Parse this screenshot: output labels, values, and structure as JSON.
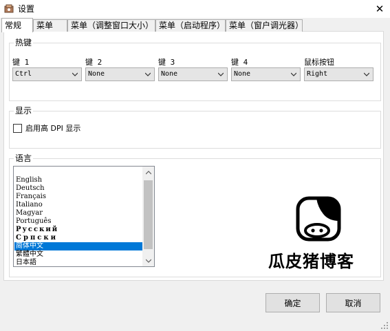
{
  "window": {
    "title": "设置",
    "close_glyph": "✕"
  },
  "tabs": [
    {
      "label": "常规",
      "active": true
    },
    {
      "label": "菜单"
    },
    {
      "label": "菜单（调整窗口大小）"
    },
    {
      "label": "菜单（启动程序）"
    },
    {
      "label": "菜单（窗户调光器）"
    }
  ],
  "hotkeys": {
    "group_label": "热键",
    "fields": [
      {
        "label": "键 1",
        "value": "Ctrl"
      },
      {
        "label": "键 2",
        "value": "None"
      },
      {
        "label": "键 3",
        "value": "None"
      },
      {
        "label": "键 4",
        "value": "None"
      },
      {
        "label": "鼠标按钮",
        "value": "Right"
      }
    ]
  },
  "display": {
    "group_label": "显示",
    "high_dpi_label": "启用高 DPI 显示",
    "high_dpi_checked": false
  },
  "language": {
    "group_label": "语言",
    "items": [
      "English",
      "Deutsch",
      "Français",
      "Italiano",
      "Magyar",
      "Português",
      "Русский",
      "Српски",
      "简体中文",
      "繁體中文",
      "日本語"
    ],
    "selected": "简体中文"
  },
  "watermark": {
    "text": "瓜皮猪博客"
  },
  "buttons": {
    "ok": "确定",
    "cancel": "取消"
  },
  "icons": {
    "app": "app-icon",
    "close": "close-icon",
    "chevron": "chevron-down-icon",
    "scroll_up": "scroll-up-icon",
    "scroll_down": "scroll-down-icon",
    "grip": "resize-grip-icon"
  },
  "colors": {
    "selection": "#0078d7",
    "panel": "#ffffff",
    "window_bg": "#f0f0f0"
  }
}
